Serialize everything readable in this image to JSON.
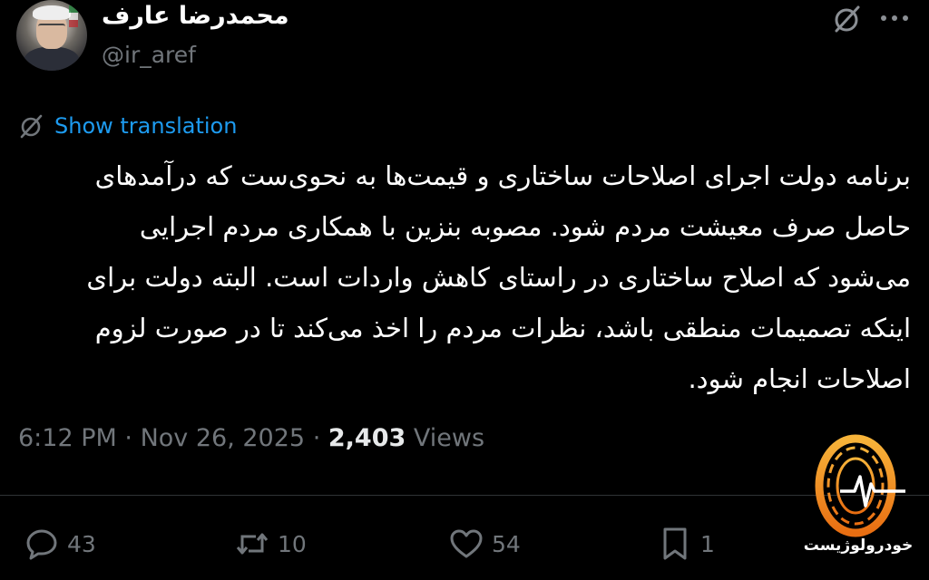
{
  "author": {
    "display_name": "محمدرضا عارف",
    "handle": "@ir_aref"
  },
  "translation": {
    "label": "Show translation"
  },
  "tweet": {
    "lines": [
      "برنامه دولت اجرای اصلاحات ساختاری و قیمت‌ها به نحوی‌ست که درآمدهای",
      "حاصل صرف معیشت مردم شود. مصوبه بنزین با همکاری مردم اجرایی",
      "می‌شود که اصلاح ساختاری در راستای کاهش واردات است. البته دولت برای",
      "اینکه تصمیمات منطقی باشد، نظرات مردم را اخذ می‌کند تا در صورت لزوم",
      "اصلاحات انجام شود."
    ]
  },
  "meta": {
    "time": "6:12 PM",
    "separator": "·",
    "date": "Nov 26, 2025",
    "views_count": "2,403",
    "views_label": "Views"
  },
  "actions": {
    "reply_count": "43",
    "repost_count": "10",
    "like_count": "54",
    "bookmark_count": "1"
  },
  "watermark": {
    "text": "خودرولوژیست"
  },
  "icons": {
    "header_right": [
      "grok-icon",
      "more-icon"
    ],
    "translate": "translate-icon",
    "actions": [
      "reply-icon",
      "repost-icon",
      "like-icon",
      "bookmark-icon"
    ]
  },
  "colors": {
    "background": "#000000",
    "text": "#ffffff",
    "muted": "#71767b",
    "link": "#1d9bf0",
    "watermark_orange": "#f39a1e"
  }
}
